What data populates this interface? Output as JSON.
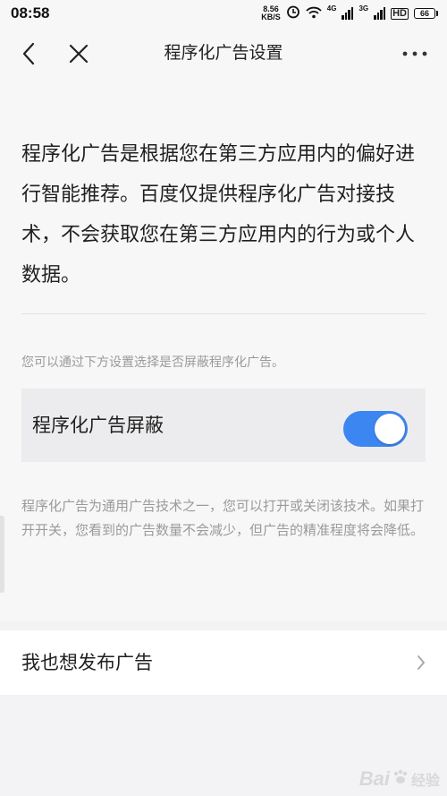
{
  "status_bar": {
    "time": "08:58",
    "net_speed_value": "8.56",
    "net_speed_unit": "KB/S",
    "signal1_tag": "4G",
    "signal2_tag": "3G",
    "hd_label": "HD",
    "battery_level": "66"
  },
  "nav": {
    "title": "程序化广告设置"
  },
  "intro_text": "程序化广告是根据您在第三方应用内的偏好进行智能推荐。百度仅提供程序化广告对接技术，不会获取您在第三方应用内的行为或个人数据。",
  "hint_text": "您可以通过下方设置选择是否屏蔽程序化广告。",
  "toggle": {
    "label": "程序化广告屏蔽",
    "on": true,
    "color": "#3b86f0"
  },
  "description_text": "程序化广告为通用广告技术之一，您可以打开或关闭该技术。如果打开开关，您看到的广告数量不会减少，但广告的精准程度将会降低。",
  "publish_row": {
    "label": "我也想发布广告"
  },
  "watermark": {
    "logo_text": "Bai",
    "suffix": "经验"
  }
}
